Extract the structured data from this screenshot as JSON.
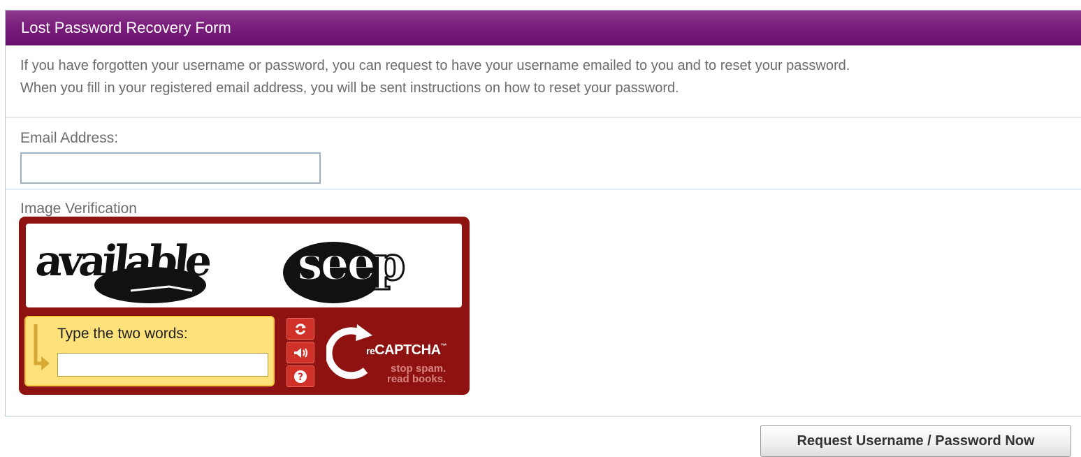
{
  "form": {
    "title": "Lost Password Recovery Form",
    "intro_line1": "If you have forgotten your username or password, you can request to have your username emailed to you and to reset your password.",
    "intro_line2": "When you fill in your registered email address, you will be sent instructions on how to reset your password.",
    "email_label": "Email Address:",
    "email_value": "",
    "verification_label": "Image Verification",
    "submit_label": "Request Username / Password Now"
  },
  "captcha": {
    "word1": "available",
    "word2": "seep",
    "prompt": "Type the two words:",
    "response_value": "",
    "buttons": [
      "refresh-icon",
      "audio-icon",
      "help-icon"
    ],
    "brand_prefix": "re",
    "brand_name": "CAPTCHA",
    "brand_tm": "™",
    "tagline1": "stop spam.",
    "tagline2": "read books."
  },
  "colors": {
    "header": "#7a1f7c",
    "captcha_frame": "#8e1210",
    "captcha_response_bg": "#fde17a",
    "captcha_button": "#d0322a"
  }
}
